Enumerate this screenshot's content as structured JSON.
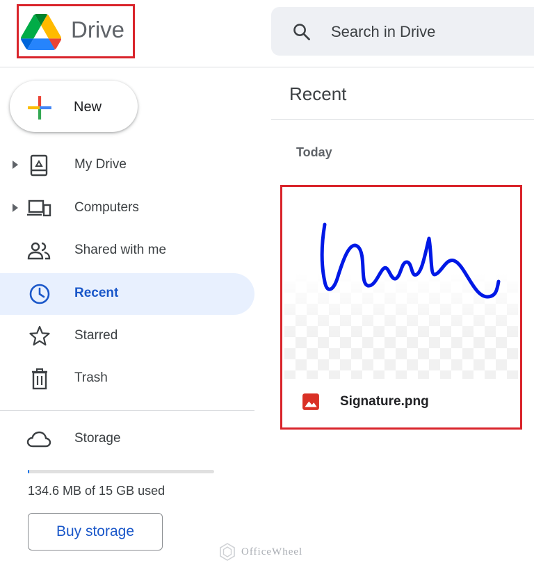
{
  "header": {
    "app_title": "Drive",
    "logo_icon": "google-drive-logo",
    "search_placeholder": "Search in Drive",
    "search_icon": "search-icon"
  },
  "sidebar": {
    "new_button_label": "New",
    "items": [
      {
        "label": "My Drive",
        "icon": "my-drive-icon",
        "expandable": true,
        "active": false
      },
      {
        "label": "Computers",
        "icon": "computers-icon",
        "expandable": true,
        "active": false
      },
      {
        "label": "Shared with me",
        "icon": "people-icon",
        "expandable": false,
        "active": false
      },
      {
        "label": "Recent",
        "icon": "clock-icon",
        "expandable": false,
        "active": true
      },
      {
        "label": "Starred",
        "icon": "star-icon",
        "expandable": false,
        "active": false
      },
      {
        "label": "Trash",
        "icon": "trash-icon",
        "expandable": false,
        "active": false
      }
    ],
    "storage": {
      "label": "Storage",
      "icon": "cloud-icon",
      "used_text": "134.6 MB of 15 GB used",
      "used_fraction": 0.009,
      "buy_label": "Buy storage"
    }
  },
  "main": {
    "title": "Recent",
    "sections": [
      {
        "label": "Today",
        "files": [
          {
            "name": "Signature.png",
            "type_icon": "image-file-icon"
          }
        ]
      }
    ]
  },
  "watermark": {
    "text": "OfficeWheel"
  },
  "colors": {
    "accent_blue": "#1a57c9",
    "active_bg": "#e8f0fe",
    "highlight_red": "#d9242b",
    "signature_blue": "#0019e6",
    "image_icon_red": "#d93025"
  }
}
